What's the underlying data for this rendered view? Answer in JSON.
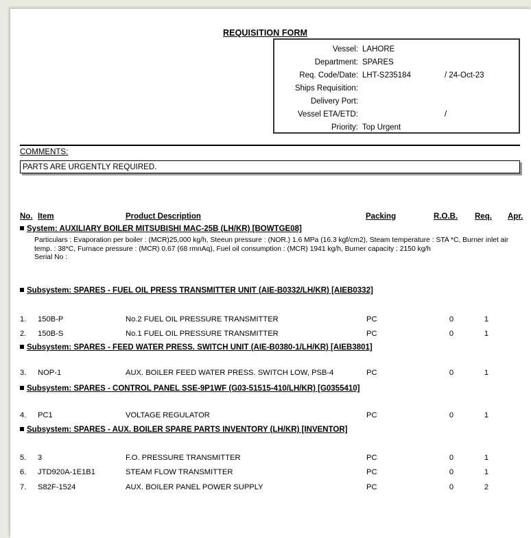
{
  "document": {
    "title": "REQUISITION FORM"
  },
  "vessel_info": {
    "rows": [
      {
        "label": "Vessel:",
        "value": "LAHORE",
        "extra": ""
      },
      {
        "label": "Department:",
        "value": "SPARES",
        "extra": ""
      },
      {
        "label": "Req. Code/Date:",
        "value": "LHT-S235184",
        "extra": "/  24-Oct-23"
      },
      {
        "label": "Ships Requisition:",
        "value": "",
        "extra": ""
      },
      {
        "label": "Delivery Port:",
        "value": "",
        "extra": ""
      },
      {
        "label": "Vessel ETA/ETD:",
        "value": "",
        "extra": "/"
      },
      {
        "label": "Priority:",
        "value": "Top Urgent",
        "extra": ""
      }
    ]
  },
  "comments": {
    "label": "COMMENTS:",
    "text": "PARTS ARE URGENTLY REQUIRED."
  },
  "table": {
    "headers": {
      "no": "No.",
      "item": "Item",
      "description": "Product Description",
      "packing": "Packing",
      "rob": "R.O.B.",
      "req": "Req.",
      "apr": "Apr."
    }
  },
  "system": {
    "label": "System: AUXILIARY BOILER MITSUBISHI MAC-25B (LH/KR) [BOWTGE08]",
    "particulars": "Particulars : Evaporation per boiler : (MCR)25,000 kg/h, Steeun pressure : (NOR.) 1.6 MPa (16.3 kgf/cm2), Steam temperature : STA *C, Burner inlet air temp. : 38*C, Furnace pressure : (MCR) 0.67 (68 rmnAq), Fuel oil consumption : (MCR) 1941 kg/h, Burner capacity : 2150 kg/h",
    "serial": "Serial No :"
  },
  "subsystems": [
    {
      "label": "Subsystem: SPARES - FUEL OIL PRESS TRANSMITTER UNIT (AIE-B0332/LH/KR) [AIEB0332]",
      "items": [
        {
          "no": "1.",
          "item": "150B-P",
          "description": "No.2 FUEL OIL PRESSURE TRANSMITTER",
          "packing": "PC",
          "rob": "0",
          "req": "1",
          "apr": ""
        },
        {
          "no": "2.",
          "item": "150B-S",
          "description": "No.1 FUEL OIL PRESSURE TRANSMITTER",
          "packing": "PC",
          "rob": "0",
          "req": "1",
          "apr": ""
        }
      ]
    },
    {
      "label": "Subsystem: SPARES - FEED WATER PRESS. SWITCH UNIT (AIE-B0380-1/LH/KR) [AIEB3801]",
      "items": [
        {
          "no": "3.",
          "item": "NOP-1",
          "description": "AUX. BOILER FEED WATER PRESS. SWITCH LOW, PSB-4",
          "packing": "PC",
          "rob": "0",
          "req": "1",
          "apr": ""
        }
      ]
    },
    {
      "label": "Subsystem: SPARES -  CONTROL PANEL SSE-9P1WF (G03-51515-410/LH/KR) [G0355410]",
      "items": [
        {
          "no": "4.",
          "item": "PC1",
          "description": "VOLTAGE REGULATOR",
          "packing": "PC",
          "rob": "0",
          "req": "1",
          "apr": ""
        }
      ]
    },
    {
      "label": "Subsystem: SPARES - AUX. BOILER SPARE PARTS INVENTORY (LH/KR) [INVENTOR]",
      "items": [
        {
          "no": "5.",
          "item": "3",
          "description": "F.O. PRESSURE TRANSMITTER",
          "packing": "PC",
          "rob": "0",
          "req": "1",
          "apr": ""
        },
        {
          "no": "6.",
          "item": "JTD920A-1E1B1",
          "description": "STEAM FLOW TRANSMITTER",
          "packing": "PC",
          "rob": "0",
          "req": "1",
          "apr": ""
        },
        {
          "no": "7.",
          "item": "S82F-1524",
          "description": "AUX. BOILER PANEL POWER SUPPLY",
          "packing": "PC",
          "rob": "0",
          "req": "2",
          "apr": ""
        }
      ]
    }
  ],
  "colors": {
    "page_background": "#e8ebe2",
    "sheet": "#ffffff",
    "text": "#000000",
    "box_border": "#333333",
    "shadow": "#9a9a9a"
  }
}
